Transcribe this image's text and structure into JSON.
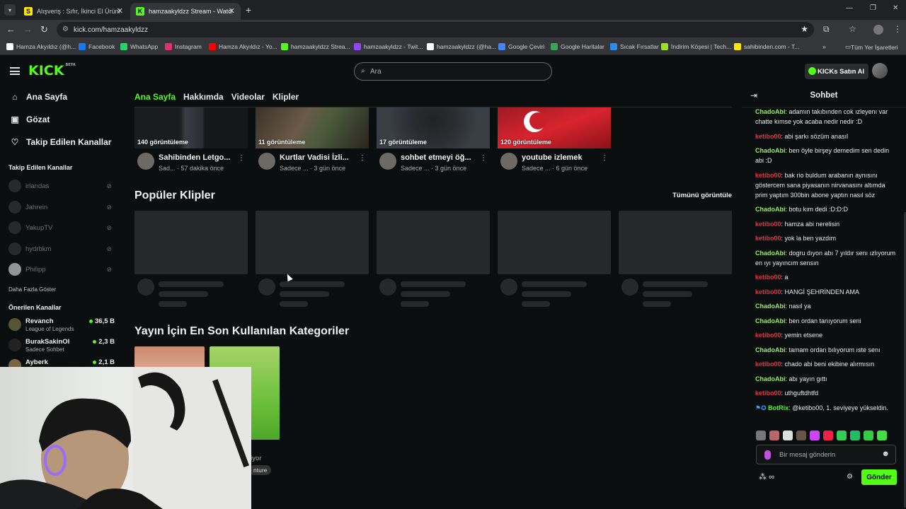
{
  "browser": {
    "tabs": [
      {
        "title": "Alışveriş : Sıfır, İkinci El Ürünler",
        "favicon": "S"
      },
      {
        "title": "hamzaakyldzz Stream - Watch L",
        "favicon": "K"
      }
    ],
    "url": "kick.com/hamzaakyldzz",
    "bookmarks": [
      {
        "label": "Hamza Akyıldız (@h...",
        "icon": "x-icon"
      },
      {
        "label": "Facebook",
        "icon": "facebook-icon"
      },
      {
        "label": "WhatsApp",
        "icon": "whatsapp-icon"
      },
      {
        "label": "Instagram",
        "icon": "instagram-icon"
      },
      {
        "label": "Hamza Akyıldız - Yo...",
        "icon": "youtube-icon"
      },
      {
        "label": "hamzaakyldzz Strea...",
        "icon": "kick-icon"
      },
      {
        "label": "hamzaakyldzz - Twit...",
        "icon": "twitch-icon"
      },
      {
        "label": "hamzaakyldzz (@ha...",
        "icon": "tiktok-icon"
      },
      {
        "label": "Google Çeviri",
        "icon": "translate-icon"
      },
      {
        "label": "Google Haritalar",
        "icon": "maps-icon"
      },
      {
        "label": "Sıcak Fırsatlar",
        "icon": "deal-icon"
      },
      {
        "label": "İndirim Köşesi | Tech...",
        "icon": "discount-icon"
      },
      {
        "label": "sahibinden.com - T...",
        "icon": "sahibinden-icon"
      }
    ],
    "all_bookmarks": "Tüm Yer İşaretleri"
  },
  "header": {
    "logo": "KICK",
    "logo_badge": "BETA",
    "search_placeholder": "Ara",
    "kicks_button": "KICKs Satın Al"
  },
  "sidebar": {
    "nav": [
      {
        "label": "Ana Sayfa",
        "icon": "home-icon"
      },
      {
        "label": "Gözat",
        "icon": "browse-icon"
      },
      {
        "label": "Takip Edilen Kanallar",
        "icon": "heart-icon"
      }
    ],
    "following_title": "Takip Edilen Kanallar",
    "following": [
      "irlandas",
      "Jahrein",
      "YakupTV",
      "hydrbkm",
      "Philipp"
    ],
    "show_more": "Daha Fazla Göster",
    "recommended_title": "Önerilen Kanallar",
    "recommended": [
      {
        "name": "Revanch",
        "category": "League of Legends",
        "viewers": "36,5 B"
      },
      {
        "name": "BurakSakinOl",
        "category": "Sadece Sohbet",
        "viewers": "2,3 B"
      },
      {
        "name": "Ayberk",
        "category": "",
        "viewers": "2,1 B"
      }
    ]
  },
  "channel_tabs": [
    "Ana Sayfa",
    "Hakkımda",
    "Videolar",
    "Klipler"
  ],
  "videos": [
    {
      "views": "140 görüntüleme",
      "title": "Sahibinden Letgo...",
      "category": "Sad...",
      "ago": "57 dakika önce"
    },
    {
      "views": "11 görüntüleme",
      "title": "Kurtlar Vadisi İzli...",
      "category": "Sadece ...",
      "ago": "3 gün önce"
    },
    {
      "views": "17 görüntüleme",
      "title": "sohbet etmeyi öğ...",
      "category": "Sadece ...",
      "ago": "3 gün önce"
    },
    {
      "views": "120 görüntüleme",
      "title": "youtube izlemek",
      "category": "Sadece ...",
      "ago": "6 gün önce"
    }
  ],
  "clips_section": {
    "title": "Popüler Klipler",
    "see_all": "Tümünü görüntüle"
  },
  "categories_section": {
    "title": "Yayın İçin En Son Kullanılan Kategoriler",
    "partial_label": "liyor",
    "partial_tag": "nture"
  },
  "chat": {
    "title": "Sohbet",
    "messages": [
      {
        "user": "ChadoAbi",
        "text": "adamın takıbınden cok ızleyenı var chatte kımse yok acaba nedir nedir :D",
        "color": "#9ee86a"
      },
      {
        "user": "ketibo00",
        "text": "abi şarkı sözüm anasıl",
        "color": "#e0354a"
      },
      {
        "user": "ChadoAbi",
        "text": "ben öyle birşey demedim sen dedin abi :D",
        "color": "#9ee86a"
      },
      {
        "user": "ketibo00",
        "text": "bak rio buldum arabanın aynısını göstercem sana piyasanın nirvanasını altımda prim yaptım 300bin abone yaptın nasıl söz",
        "color": "#e0354a"
      },
      {
        "user": "ChadoAbi",
        "text": "botu kım dedi :D:D:D",
        "color": "#9ee86a"
      },
      {
        "user": "ketibo00",
        "text": "hamza abi nerelisin",
        "color": "#e0354a"
      },
      {
        "user": "ketibo00",
        "text": "yok la ben yazdım",
        "color": "#e0354a"
      },
      {
        "user": "ChadoAbi",
        "text": "dogru dıyon abı 7 yıldır senı ızlıyorum en ıyı yayıncım sensın",
        "color": "#9ee86a"
      },
      {
        "user": "ketibo00",
        "text": "a",
        "color": "#e0354a"
      },
      {
        "user": "ketibo00",
        "text": "HANGİ ŞEHRİNDEN AMA",
        "color": "#e0354a"
      },
      {
        "user": "ChadoAbi",
        "text": "nasıl ya",
        "color": "#9ee86a"
      },
      {
        "user": "ChadoAbi",
        "text": "ben ordan tanıyorum seni",
        "color": "#9ee86a"
      },
      {
        "user": "ketibo00",
        "text": "yemin etsene",
        "color": "#e0354a"
      },
      {
        "user": "ChadoAbi",
        "text": "tamam ordan bılıyorum ıste senı",
        "color": "#9ee86a"
      },
      {
        "user": "ketibo00",
        "text": "chado abi beni ekibine alırmısın",
        "color": "#e0354a"
      },
      {
        "user": "ChadoAbi",
        "text": "abı yayın gıttı",
        "color": "#9ee86a"
      },
      {
        "user": "ketibo00",
        "text": "uthguftdhtfd",
        "color": "#e0354a"
      },
      {
        "user": "BotRix",
        "text": "@ketibo00, 1. seviyeye yükseldin.",
        "color": "#53fc18"
      }
    ],
    "input_placeholder": "Bir mesaj gönderin",
    "footer_points": "∞",
    "send_label": "Gönder"
  },
  "colors": {
    "accent": "#53fc18",
    "background": "#0b0e0f"
  }
}
